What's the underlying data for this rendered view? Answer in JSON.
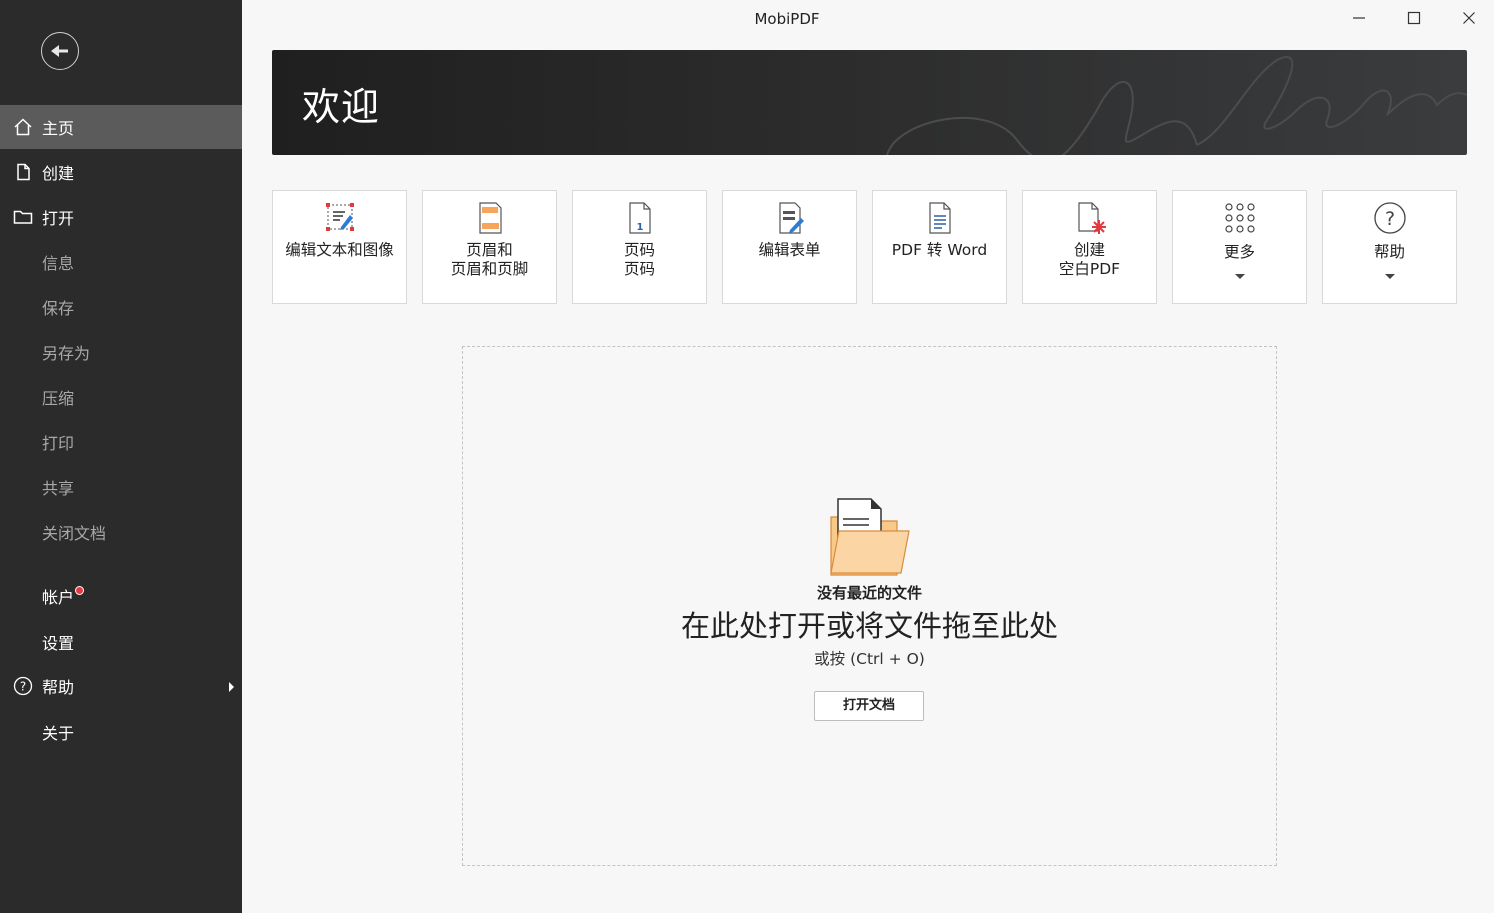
{
  "window": {
    "title": "MobiPDF"
  },
  "sidebar": {
    "items": [
      {
        "label": "主页",
        "icon": "home-icon"
      },
      {
        "label": "创建",
        "icon": "document-icon"
      },
      {
        "label": "打开",
        "icon": "folder-icon"
      },
      {
        "label": "信息"
      },
      {
        "label": "保存"
      },
      {
        "label": "另存为"
      },
      {
        "label": "压缩"
      },
      {
        "label": "打印"
      },
      {
        "label": "共享"
      },
      {
        "label": "关闭文档"
      },
      {
        "label": "帐户"
      },
      {
        "label": "设置"
      },
      {
        "label": "帮助",
        "icon": "help-circle-icon"
      },
      {
        "label": "关于"
      }
    ]
  },
  "banner": {
    "title": "欢迎"
  },
  "tiles": [
    {
      "line1": "编辑文本和图像",
      "line2": "",
      "icon": "edit-text-image-icon"
    },
    {
      "line1": "页眉和",
      "line2": "页眉和页脚",
      "icon": "header-footer-icon"
    },
    {
      "line1": "页码",
      "line2": "页码",
      "icon": "page-number-icon"
    },
    {
      "line1": "编辑表单",
      "line2": "",
      "icon": "edit-form-icon"
    },
    {
      "line1": "PDF 转 Word",
      "line2": "",
      "icon": "pdf-to-word-icon"
    },
    {
      "line1": "创建",
      "line2": "空白PDF",
      "icon": "create-blank-pdf-icon"
    },
    {
      "line1": "更多",
      "line2": "",
      "icon": "more-grid-icon"
    },
    {
      "line1": "帮助",
      "line2": "",
      "icon": "help-icon"
    }
  ],
  "dropzone": {
    "no_recent": "没有最近的文件",
    "main": "在此处打开或将文件拖至此处",
    "hint": "或按 (Ctrl + O)",
    "button": "打开文档"
  },
  "colors": {
    "sidebar_bg": "#2b2b2b",
    "sidebar_active": "#5b5b5b",
    "accent_blue": "#2e7bd4",
    "accent_red": "#e03a3e",
    "accent_orange": "#f6a55b"
  }
}
